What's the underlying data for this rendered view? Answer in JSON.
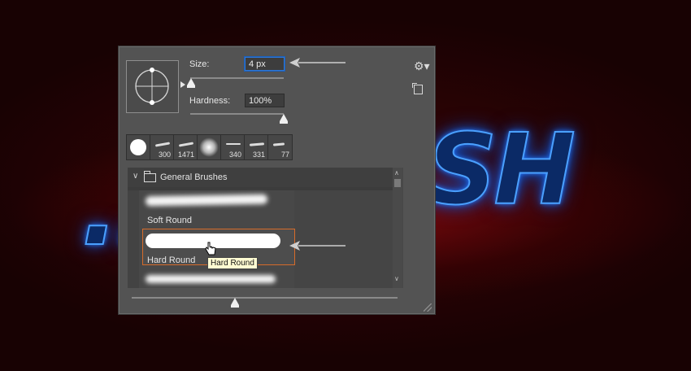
{
  "background": {
    "text_left": "...",
    "text_right": "SH"
  },
  "brush_panel": {
    "size_label": "Size:",
    "size_value": "4 px",
    "size_slider_level": 0.02,
    "hardness_label": "Hardness:",
    "hardness_value": "100%",
    "hardness_slider_level": 1.0,
    "settings_icon": "gear-icon",
    "new_preset_icon": "new-preset-icon",
    "recent_brushes": [
      {
        "num": ""
      },
      {
        "num": "300"
      },
      {
        "num": "1471"
      },
      {
        "num": ""
      },
      {
        "num": "340"
      },
      {
        "num": "331"
      },
      {
        "num": "77"
      }
    ],
    "group": {
      "title": "General Brushes",
      "expanded": true
    },
    "brushes": [
      {
        "label": "Soft Round"
      },
      {
        "label": "Hard Round",
        "selected": true
      }
    ],
    "tooltip": "Hard Round",
    "colors": {
      "panel": "#535353",
      "selection": "#d66b2a",
      "focus": "#2f78d6"
    }
  }
}
